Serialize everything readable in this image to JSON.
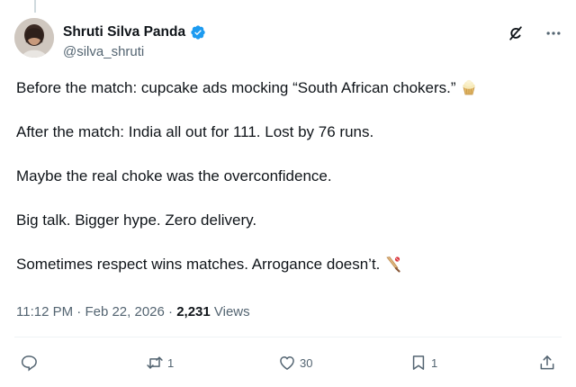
{
  "author": {
    "display_name": "Shruti Silva Panda",
    "handle": "@silva_shruti",
    "verified": true
  },
  "tweet": {
    "paragraphs": [
      {
        "text": "Before the match: cupcake ads mocking “South African chokers.”",
        "emoji": "cupcake-icon"
      },
      {
        "text": "After the match: India all out for 111. Lost by 76 runs."
      },
      {
        "text": "Maybe the real choke was the overconfidence."
      },
      {
        "text": "Big talk. Bigger hype. Zero delivery."
      },
      {
        "text": "Sometimes respect wins matches. Arrogance doesn’t.",
        "emoji": "cricket-bat-icon"
      }
    ]
  },
  "meta": {
    "time": "11:12 PM",
    "separator": " · ",
    "date": "Feb 22, 2026",
    "views_count": "2,231",
    "views_label": " Views"
  },
  "actions": {
    "replies": "",
    "reposts": "1",
    "likes": "30",
    "bookmarks": "1"
  },
  "icons": [
    "reply-icon",
    "repost-icon",
    "like-icon",
    "bookmark-icon",
    "share-icon",
    "grok-icon",
    "more-icon",
    "verified-badge-icon"
  ],
  "colors": {
    "verified": "#1d9bf0",
    "secondary_text": "#536471",
    "primary_text": "#0f1419"
  }
}
